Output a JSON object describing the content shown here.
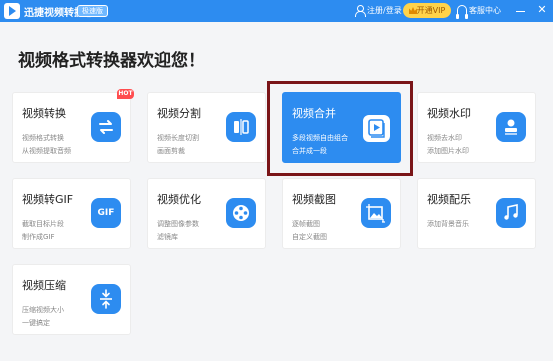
{
  "titlebar": {
    "app_title": "迅捷视频转换器",
    "edition_badge": "极速版",
    "login_label": "注册/登录",
    "vip_label": "开通VIP",
    "help_label": "客服中心",
    "minimize_icon": "minimize-icon",
    "close_icon": "close-icon",
    "close_glyph": "✕"
  },
  "heading": "视频格式转换器欢迎您！",
  "hot_badge": "HOT",
  "cards": [
    {
      "title": "视频转换",
      "line1": "视频格式转换",
      "line2": "从视频提取音频",
      "icon": "convert-icon"
    },
    {
      "title": "视频分割",
      "line1": "视频长度切割",
      "line2": "画面剪裁",
      "icon": "split-icon"
    },
    {
      "title": "视频合并",
      "line1": "多段视频自由组合",
      "line2": "合并成一段",
      "icon": "merge-play-icon",
      "active": true
    },
    {
      "title": "视频水印",
      "line1": "视频去水印",
      "line2": "添加图片水印",
      "icon": "watermark-stamp-icon"
    },
    {
      "title": "视频转GIF",
      "line1": "截取目标片段",
      "line2": "制作成GIF",
      "icon": "gif-icon",
      "icon_text": "GIF"
    },
    {
      "title": "视频优化",
      "line1": "调整图像参数",
      "line2": "滤镜库",
      "icon": "film-reel-icon"
    },
    {
      "title": "视频截图",
      "line1": "逐帧截图",
      "line2": "自定义截图",
      "icon": "screenshot-crop-icon"
    },
    {
      "title": "视频配乐",
      "line1": "添加背景音乐",
      "line2": "",
      "icon": "music-note-icon"
    },
    {
      "title": "视频压缩",
      "line1": "压缩视频大小",
      "line2": "一键搞定",
      "icon": "compress-icon"
    }
  ],
  "colors": {
    "accent": "#2d8cf0",
    "highlight_border": "#7a1518",
    "vip": "#ffd34a",
    "hot": "#ff4d4f"
  }
}
